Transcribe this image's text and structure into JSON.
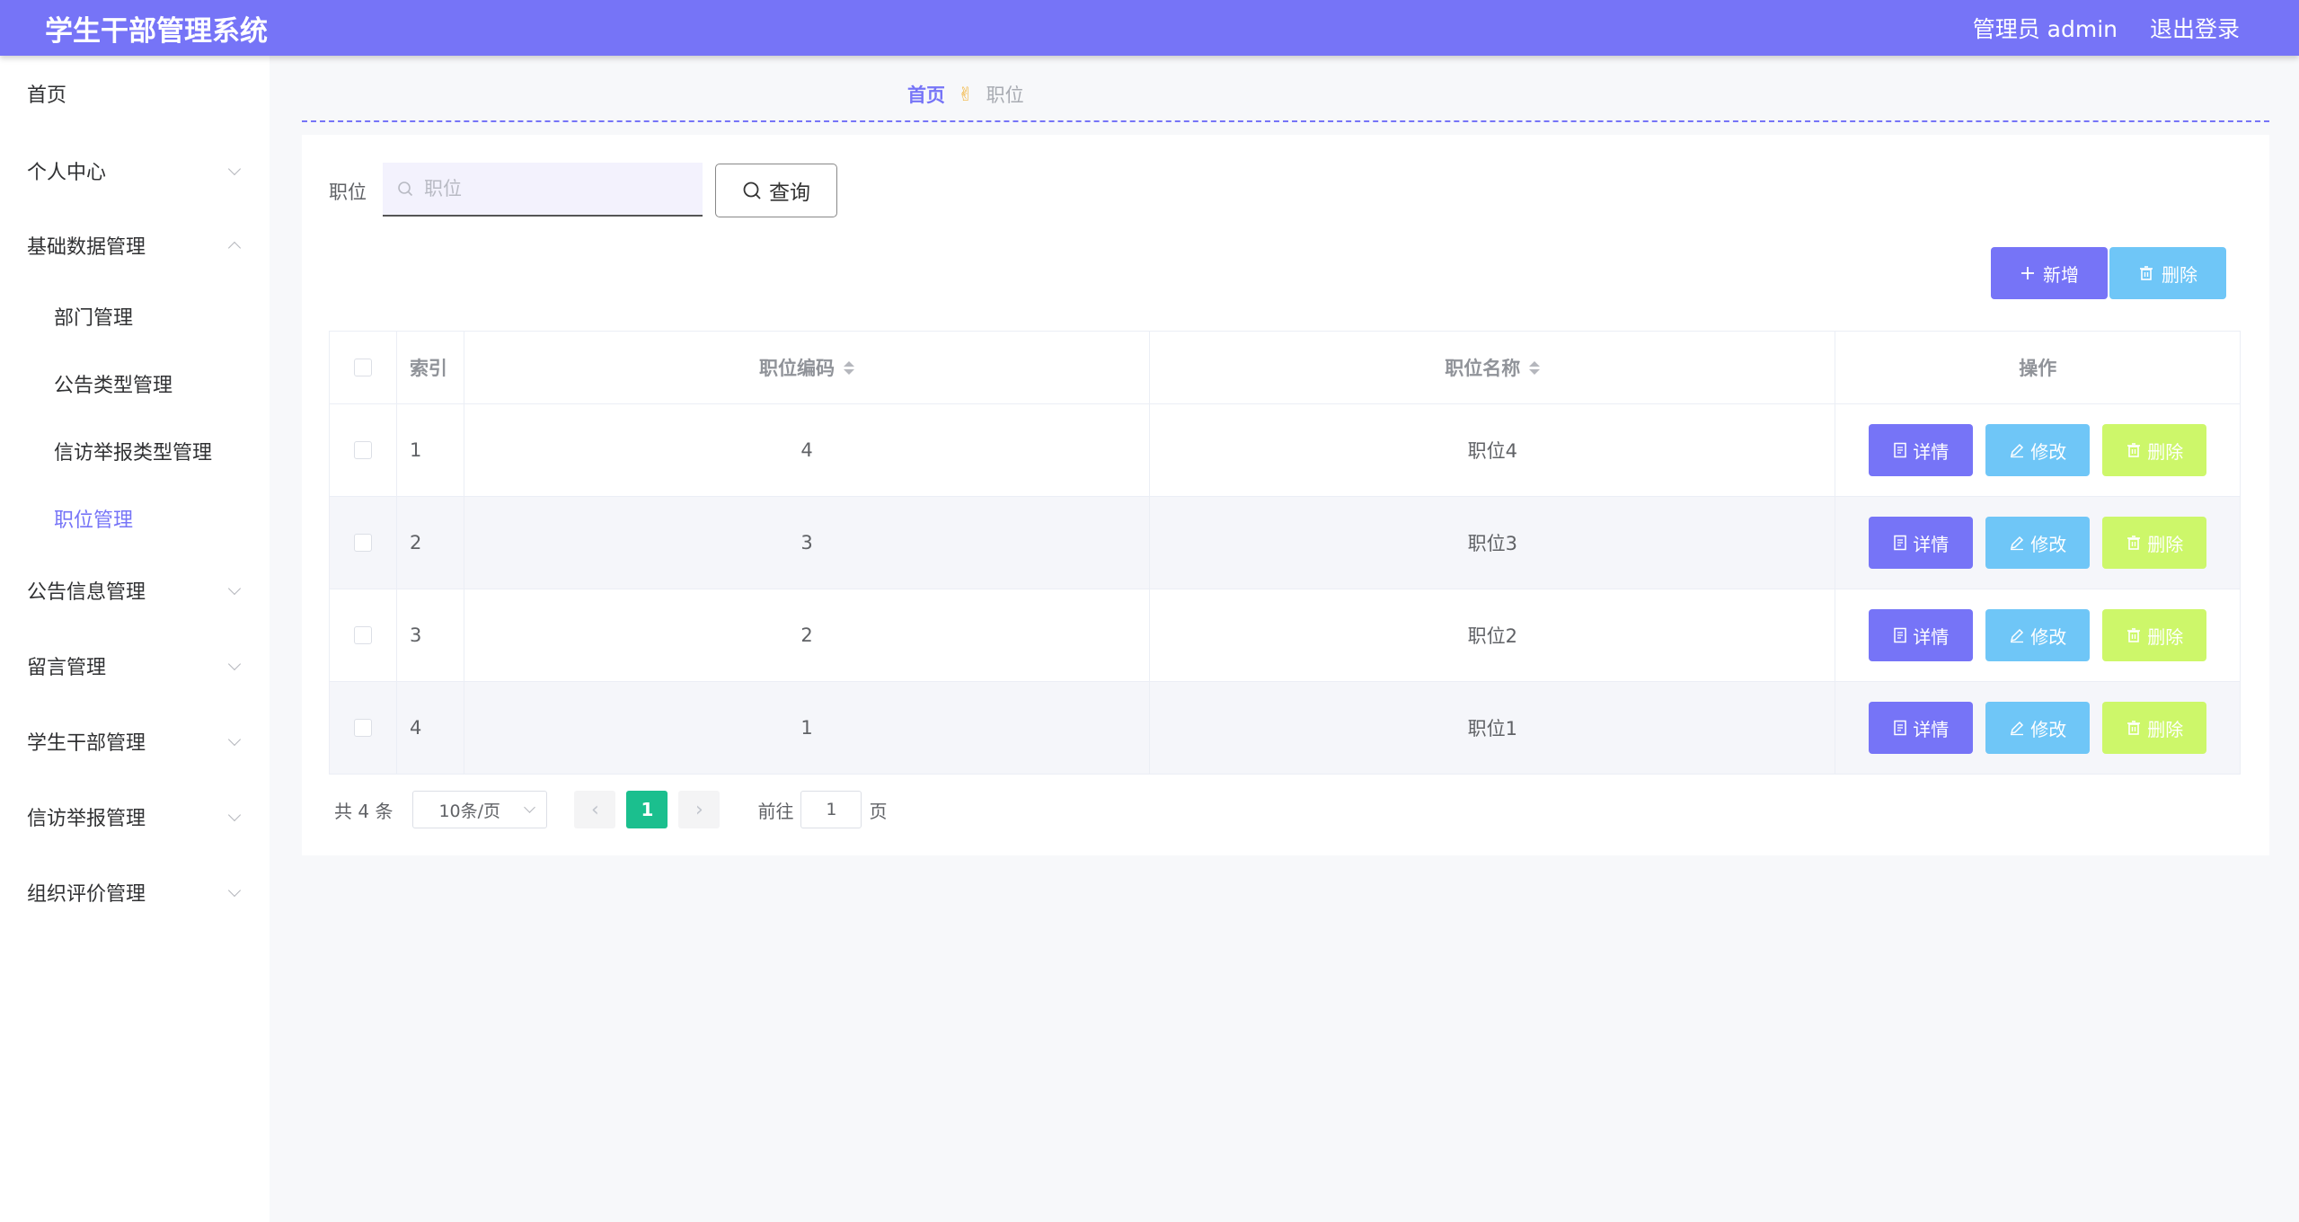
{
  "header": {
    "title": "学生干部管理系统",
    "user_label": "管理员 admin",
    "logout_label": "退出登录"
  },
  "sidebar": {
    "items": [
      {
        "label": "首页"
      },
      {
        "label": "个人中心"
      },
      {
        "label": "基础数据管理"
      },
      {
        "label": "部门管理"
      },
      {
        "label": "公告类型管理"
      },
      {
        "label": "信访举报类型管理"
      },
      {
        "label": "职位管理"
      },
      {
        "label": "公告信息管理"
      },
      {
        "label": "留言管理"
      },
      {
        "label": "学生干部管理"
      },
      {
        "label": "信访举报管理"
      },
      {
        "label": "组织评价管理"
      }
    ]
  },
  "breadcrumb": {
    "home": "首页",
    "separator_icon": "✌",
    "current": "职位"
  },
  "search": {
    "label": "职位",
    "placeholder": "职位",
    "value": "",
    "query_label": "查询"
  },
  "toolbar": {
    "add_label": "新增",
    "delete_label": "删除"
  },
  "table": {
    "columns": [
      "索引",
      "职位编码",
      "职位名称",
      "操作"
    ],
    "rows": [
      {
        "index": "1",
        "code": "4",
        "name": "职位4"
      },
      {
        "index": "2",
        "code": "3",
        "name": "职位3"
      },
      {
        "index": "3",
        "code": "2",
        "name": "职位2"
      },
      {
        "index": "4",
        "code": "1",
        "name": "职位1"
      }
    ],
    "actions": {
      "detail": "详情",
      "edit": "修改",
      "delete": "删除"
    }
  },
  "pagination": {
    "total": "共 4 条",
    "page_size": "10条/页",
    "current_page": "1",
    "goto_label": "前往",
    "goto_value": "1",
    "page_suffix": "页"
  },
  "colors": {
    "primary": "#7674f7",
    "info": "#6fc6f7",
    "warning": "#cdf76a",
    "pager_active": "#1bbf8e"
  }
}
